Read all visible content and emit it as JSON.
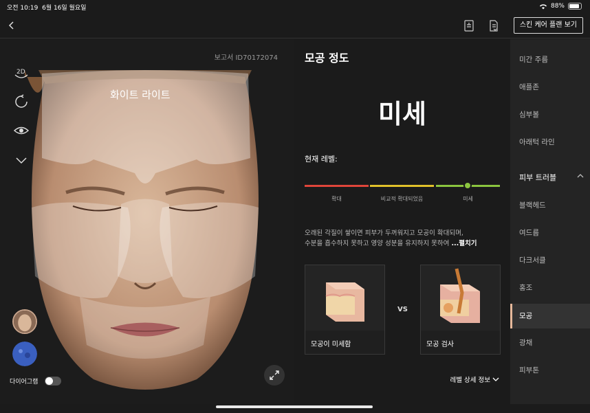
{
  "status": {
    "time": "오전 10:19",
    "date": "6월 16일 월요일",
    "battery": "88%",
    "battery_level": 0.88
  },
  "toolbar": {
    "plan_button": "스킨 케어 플랜 보기"
  },
  "left": {
    "report_id": "보고서 ID70172074",
    "overlay_label": "화이트 라이트",
    "tool_2d": "2D",
    "diagram_label": "다이어그램"
  },
  "main": {
    "section_title": "모공 정도",
    "result": "미세",
    "current_level_label": "현재 레벨:",
    "scale": [
      {
        "label": "확대",
        "color": "#e0453a"
      },
      {
        "label": "비교적 확대되었음",
        "color": "#e2c22a"
      },
      {
        "label": "미세",
        "color": "#8bc53f"
      }
    ],
    "current_index": 2,
    "description_line1": "오래된 각질이 쌓이면 피부가 두꺼워지고 모공이 확대되며,",
    "description_line2": "수분을 흡수하지 못하고 영양 성분을 유지하지 못하여",
    "expand_link": "...펼치기",
    "card_left": "모공이 미세함",
    "vs": "VS",
    "card_right": "모공 검사",
    "level_detail": "레벨 상세 정보"
  },
  "sidebar": {
    "items_top": [
      "미간 주름",
      "애플존",
      "심부볼",
      "아래턱 라인"
    ],
    "group": "피부 트러블",
    "items_group": [
      "블랙헤드",
      "여드름",
      "다크서클",
      "홍조",
      "모공",
      "광채",
      "피부톤"
    ],
    "active": "모공"
  }
}
